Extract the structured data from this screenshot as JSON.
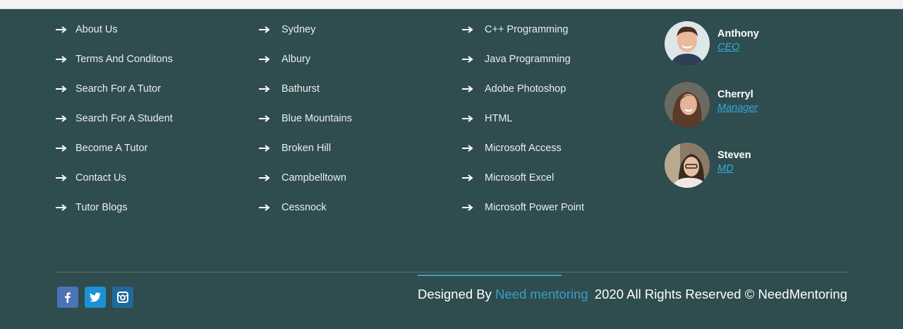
{
  "links_col1": [
    "About Us",
    "Terms And Conditons",
    "Search For A Tutor",
    "Search For A Student",
    "Become A Tutor",
    "Contact Us",
    "Tutor Blogs"
  ],
  "links_col2": [
    "Sydney",
    "Albury",
    "Bathurst",
    "Blue Mountains",
    "Broken Hill",
    "Campbelltown",
    "Cessnock"
  ],
  "links_col3": [
    "C++ Programming",
    "Java Programming",
    "Adobe Photoshop",
    "HTML",
    "Microsoft Access",
    "Microsoft Excel",
    "Microsoft Power Point"
  ],
  "team": [
    {
      "name": "Anthony",
      "role": "CEO"
    },
    {
      "name": "Cherryl",
      "role": "Manager"
    },
    {
      "name": "Steven",
      "role": "MD"
    }
  ],
  "footer": {
    "designed_by": "Designed By",
    "designer": "Need mentoring",
    "copyright": "2020 All Rights Reserved © NeedMentoring"
  },
  "social_icons": [
    {
      "name": "facebook-icon",
      "color": "#4a74b5"
    },
    {
      "name": "twitter-icon",
      "color": "#1d91d4"
    },
    {
      "name": "instagram-icon",
      "color": "#1e6a9e"
    }
  ],
  "colors": {
    "background": "#2f4c4f",
    "link": "#e9eeee",
    "accent": "#3a9fc8"
  }
}
